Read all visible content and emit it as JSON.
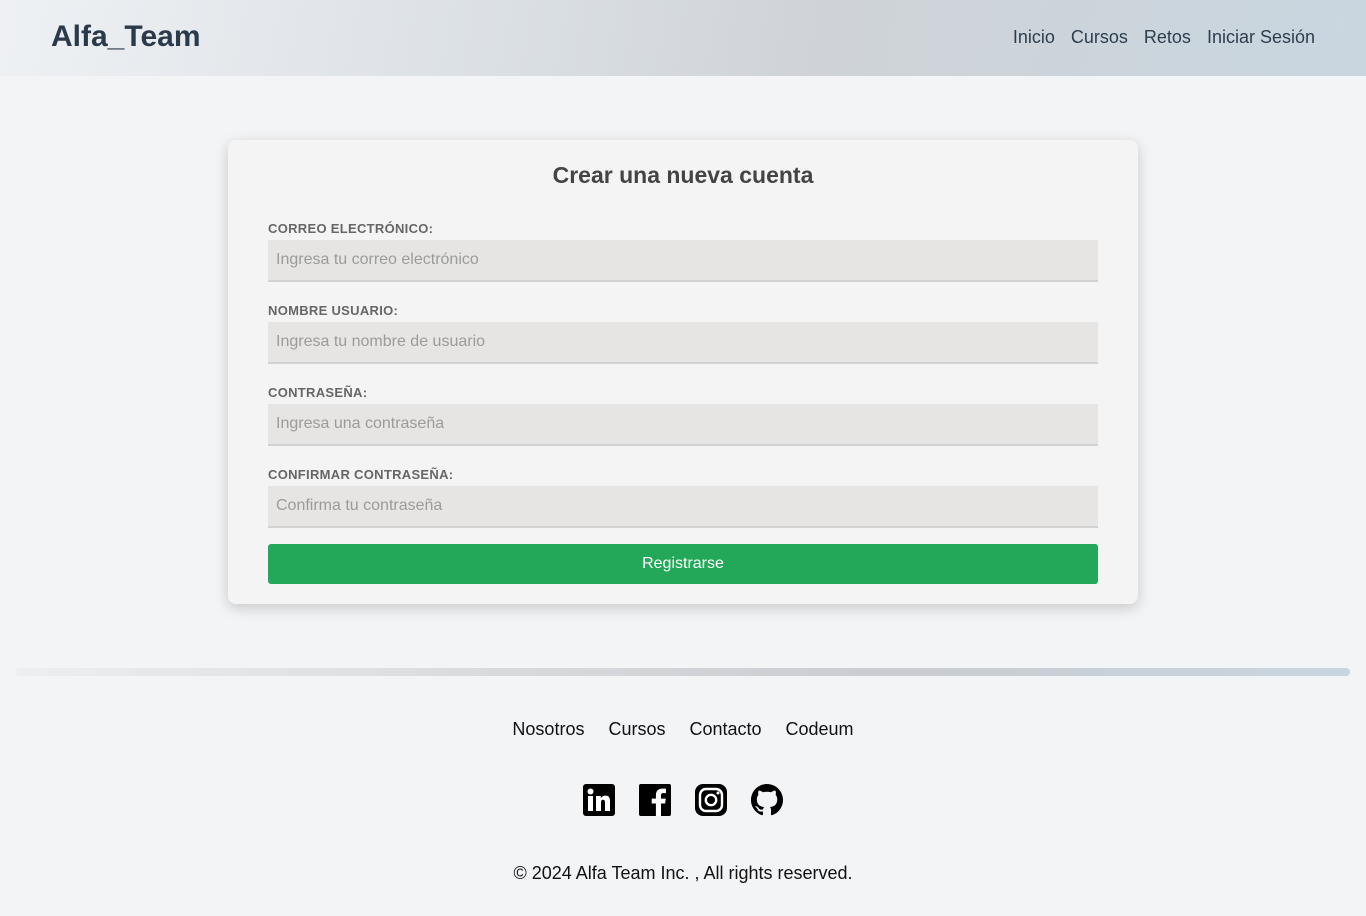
{
  "header": {
    "logo": "Alfa_Team",
    "nav": [
      "Inicio",
      "Cursos",
      "Retos",
      "Iniciar Sesión"
    ]
  },
  "form": {
    "title": "Crear una nueva cuenta",
    "fields": [
      {
        "label": "CORREO ELECTRÓNICO:",
        "placeholder": "Ingresa tu correo electrónico",
        "value": ""
      },
      {
        "label": "NOMBRE USUARIO:",
        "placeholder": "Ingresa tu nombre de usuario",
        "value": ""
      },
      {
        "label": "CONTRASEÑA:",
        "placeholder": "Ingresa una contraseña",
        "value": ""
      },
      {
        "label": "CONFIRMAR CONTRASEÑA:",
        "placeholder": "Confirma tu contraseña",
        "value": ""
      }
    ],
    "submit_label": "Registrarse",
    "submit_color": "#22a858"
  },
  "footer": {
    "links": [
      "Nosotros",
      "Cursos",
      "Contacto",
      "Codeum"
    ],
    "socials": [
      "linkedin-icon",
      "facebook-icon",
      "instagram-icon",
      "github-icon"
    ],
    "copyright": "© 2024 Alfa Team Inc. , All rights reserved."
  }
}
